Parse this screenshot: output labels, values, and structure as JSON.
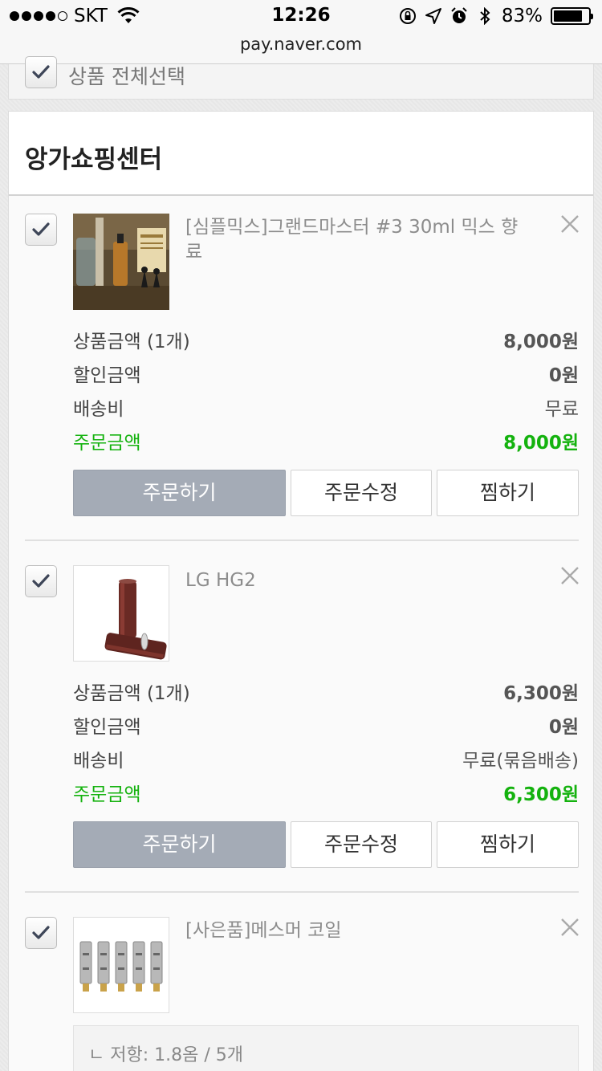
{
  "status_bar": {
    "carrier": "SKT",
    "time": "12:26",
    "battery": "83%",
    "battery_level": 0.83
  },
  "browser": {
    "url": "pay.naver.com"
  },
  "select_all": {
    "label": "상품 전체선택",
    "checked": true
  },
  "store": {
    "name": "앙가쇼핑센터"
  },
  "items": [
    {
      "title": "[심플믹스]그랜드마스터 #3 30ml 믹스 향료",
      "checked": true,
      "rows": {
        "price_label": "상품금액 (1개)",
        "price": "8,000원",
        "discount_label": "할인금액",
        "discount": "0원",
        "shipping_label": "배송비",
        "shipping": "무료",
        "total_label": "주문금액",
        "total": "8,000원"
      },
      "buttons": {
        "order": "주문하기",
        "edit": "주문수정",
        "wish": "찜하기"
      }
    },
    {
      "title": "LG HG2",
      "checked": true,
      "rows": {
        "price_label": "상품금액 (1개)",
        "price": "6,300원",
        "discount_label": "할인금액",
        "discount": "0원",
        "shipping_label": "배송비",
        "shipping": "무료(묶음배송)",
        "total_label": "주문금액",
        "total": "6,300원"
      },
      "buttons": {
        "order": "주문하기",
        "edit": "주문수정",
        "wish": "찜하기"
      }
    },
    {
      "title": "[사은품]메스머 코일",
      "checked": true,
      "option": "ㄴ 저항: 1.8옴 / 5개"
    }
  ],
  "colors": {
    "accent_green": "#14b20e",
    "primary_button": "#a4abb6"
  }
}
